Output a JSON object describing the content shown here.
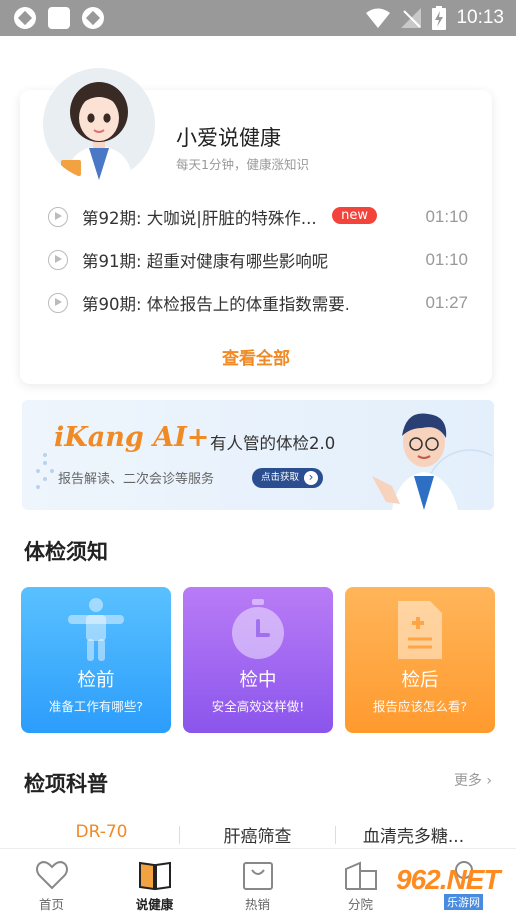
{
  "status_bar": {
    "time": "10:13"
  },
  "podcast": {
    "title": "小爱说健康",
    "subtitle": "每天1分钟，健康涨知识",
    "episodes": [
      {
        "title": "第92期: 大咖说|肝脏的特殊作...",
        "badge": "new",
        "duration": "01:10"
      },
      {
        "title": "第91期: 超重对健康有哪些影响呢",
        "duration": "01:10"
      },
      {
        "title": "第90期: 体检报告上的体重指数需要...",
        "duration": "01:27"
      }
    ],
    "view_all": "查看全部"
  },
  "banner": {
    "brand": "iKang AI+",
    "slogan": "有人管的体检2.0",
    "desc": "报告解读、二次会诊等服务",
    "button": "点击获取"
  },
  "notice": {
    "title": "体检须知",
    "tiles": [
      {
        "name": "检前",
        "desc": "准备工作有哪些?",
        "color": "#2b9dfb",
        "icon": "body-icon"
      },
      {
        "name": "检中",
        "desc": "安全高效这样做!",
        "color": "#8b55ec",
        "icon": "stopwatch-icon"
      },
      {
        "name": "检后",
        "desc": "报告应该怎么看?",
        "color": "#ff9a2e",
        "icon": "report-icon"
      }
    ]
  },
  "science": {
    "title": "检项科普",
    "more": "更多 ›",
    "tabs": [
      "DR-70",
      "肝癌筛查",
      "血清壳多糖..."
    ]
  },
  "bottom_nav": [
    {
      "label": "首页",
      "icon": "heart-icon"
    },
    {
      "label": "说健康",
      "icon": "book-icon"
    },
    {
      "label": "热销",
      "icon": "bag-icon"
    },
    {
      "label": "分院",
      "icon": "building-icon"
    },
    {
      "label": "",
      "icon": "user-icon"
    }
  ],
  "watermark": {
    "text": "962.NET",
    "sub": "乐游网"
  }
}
